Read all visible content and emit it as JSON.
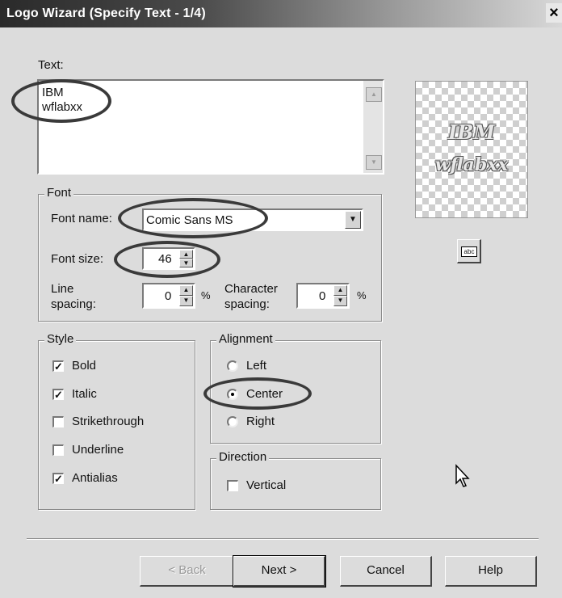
{
  "window": {
    "title": "Logo Wizard (Specify Text - 1/4)",
    "close_glyph": "×"
  },
  "text_section": {
    "label": "Text:",
    "lines": [
      "IBM",
      "wflabxx"
    ]
  },
  "font_group": {
    "title": "Font",
    "font_name_label": "Font name:",
    "font_name_value": "Comic Sans MS",
    "font_size_label": "Font size:",
    "font_size_value": "46",
    "line_spacing_label": [
      "Line",
      "spacing:"
    ],
    "line_spacing_value": "0",
    "line_spacing_unit": "%",
    "char_spacing_label": [
      "Character",
      "spacing:"
    ],
    "char_spacing_value": "0",
    "char_spacing_unit": "%"
  },
  "style_group": {
    "title": "Style",
    "options": [
      {
        "label": "Bold",
        "checked": true
      },
      {
        "label": "Italic",
        "checked": true
      },
      {
        "label": "Strikethrough",
        "checked": false
      },
      {
        "label": "Underline",
        "checked": false
      },
      {
        "label": "Antialias",
        "checked": true
      }
    ]
  },
  "alignment_group": {
    "title": "Alignment",
    "options": [
      {
        "label": "Left",
        "selected": false
      },
      {
        "label": "Center",
        "selected": true
      },
      {
        "label": "Right",
        "selected": false
      }
    ]
  },
  "direction_group": {
    "title": "Direction",
    "vertical_label": "Vertical",
    "vertical_checked": false
  },
  "preview": {
    "lines": [
      "IBM",
      "wflabxx"
    ],
    "edit_button_label": "abc"
  },
  "buttons": {
    "back": "< Back",
    "next": "Next >",
    "cancel": "Cancel",
    "help": "Help"
  },
  "icons": {
    "scroll_up": "scroll-up-arrow-icon",
    "scroll_down": "scroll-down-arrow-icon",
    "dropdown": "chevron-down-icon",
    "cursor": "mouse-pointer-icon"
  }
}
